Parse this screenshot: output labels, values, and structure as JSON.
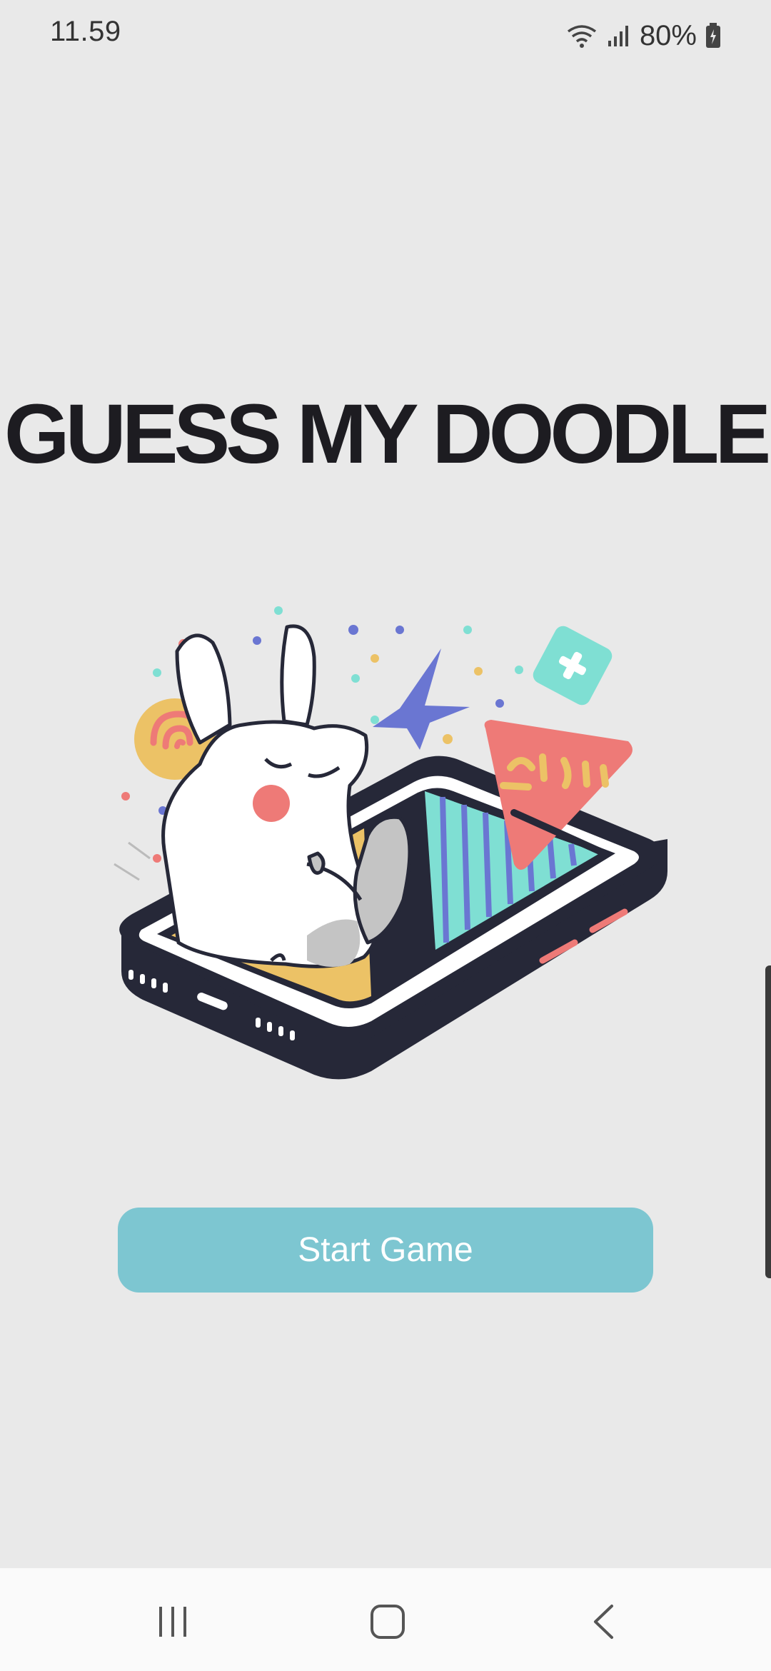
{
  "status_bar": {
    "time": "11.59",
    "battery": "80%",
    "icons": [
      "wifi-icon",
      "signal-icon",
      "battery-icon"
    ]
  },
  "app": {
    "title": "GUESS MY DOODLE",
    "start_button_label": "Start Game"
  },
  "navigation": {
    "recents": "recents-icon",
    "home": "home-icon",
    "back": "back-icon"
  },
  "colors": {
    "background": "#e9e9e9",
    "button": "#7dc6d1",
    "title": "#1d1c21",
    "accent_red": "#ee7a77",
    "accent_yellow": "#ecc266",
    "accent_blue": "#6a76d2",
    "accent_teal": "#7fdfd3"
  }
}
